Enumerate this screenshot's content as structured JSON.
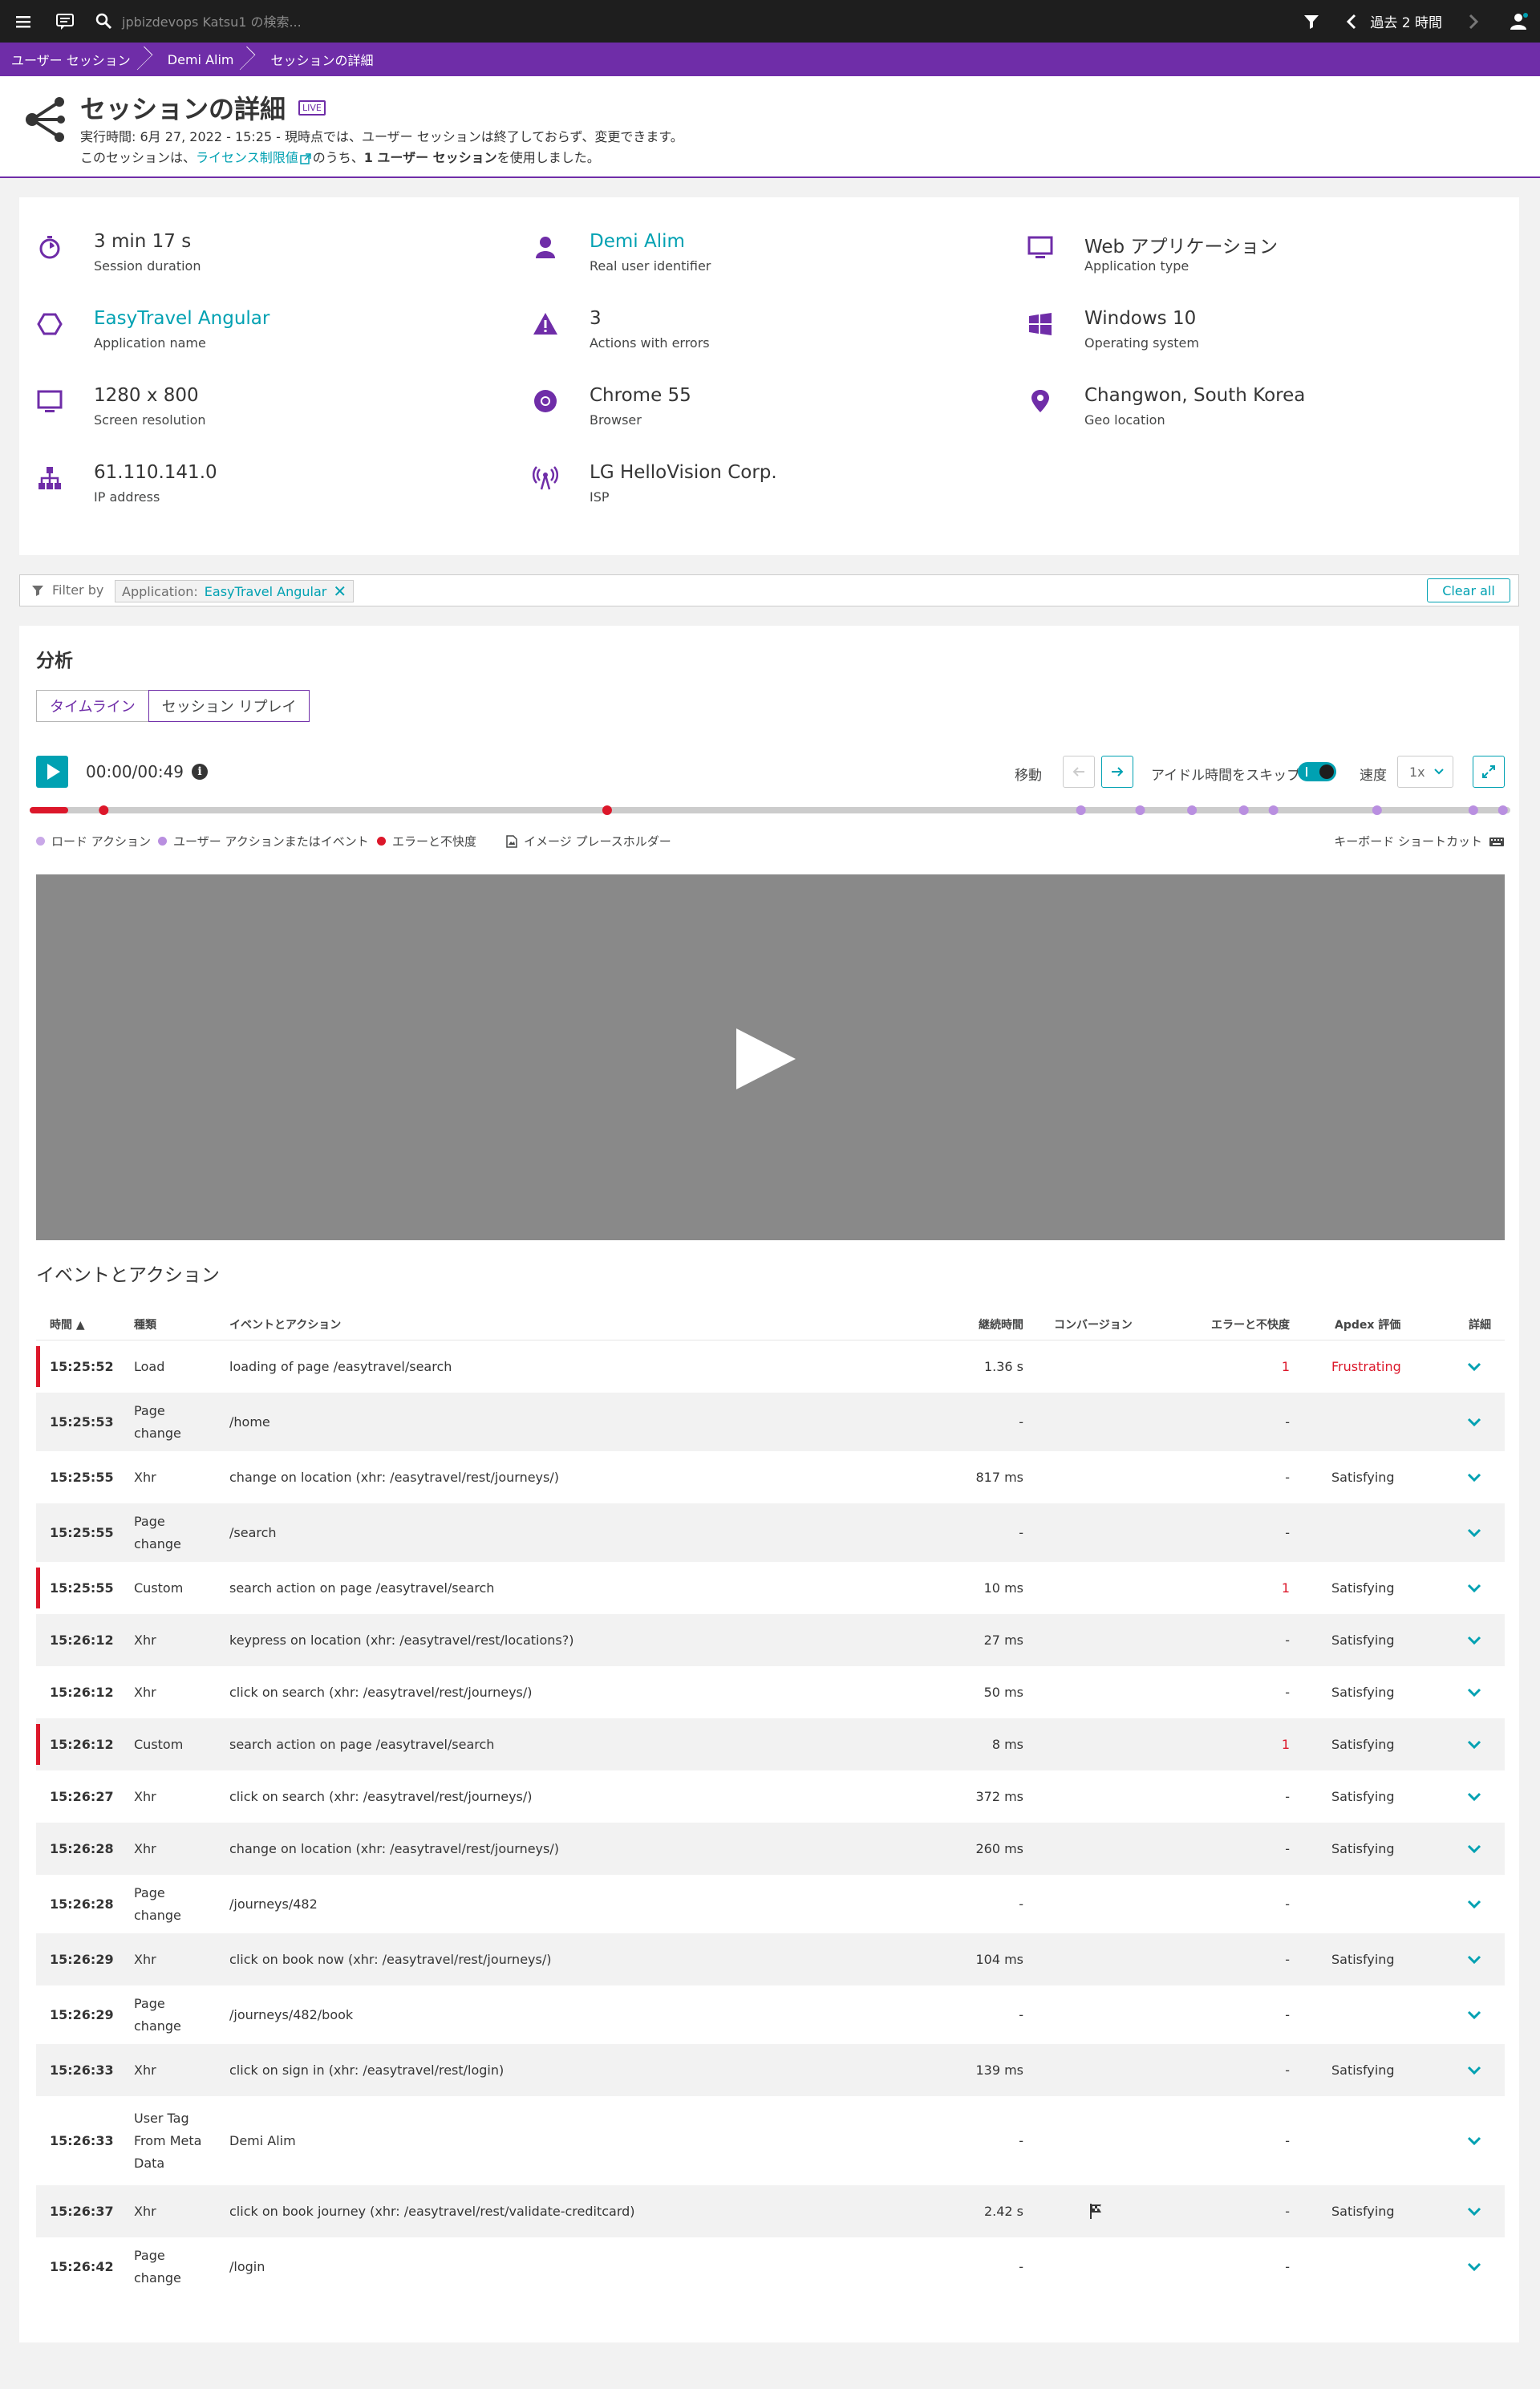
{
  "topbar": {
    "search_placeholder": "jpbizdevops Katsu1 の検索...",
    "timeframe": "過去 2 時間",
    "icons": [
      "menu-icon",
      "chat-icon",
      "search-icon",
      "filter-icon",
      "chevron-left-icon",
      "chevron-right-icon",
      "user-icon"
    ]
  },
  "breadcrumb": [
    "ユーザー セッション",
    "Demi Alim",
    "セッションの詳細"
  ],
  "header": {
    "title": "セッションの詳細",
    "badge": "LIVE",
    "line1": "実行時間: 6月 27, 2022 - 15:25 - 現時点では、ユーザー セッションは終了しておらず、変更できます。",
    "line2_prefix": "このセッションは、",
    "line2_link": "ライセンス制限値",
    "line2_mid": "のうち、",
    "line2_bold": "1 ユーザー セッション",
    "line2_suffix": "を使用しました。"
  },
  "properties": [
    {
      "icon": "stopwatch-icon",
      "value": "3 min 17 s",
      "label": "Session duration",
      "link": false
    },
    {
      "icon": "user-icon",
      "value": "Demi Alim",
      "label": "Real user identifier",
      "link": true
    },
    {
      "icon": "monitor-icon",
      "value": "Web アプリケーション",
      "label": "Application type",
      "link": false
    },
    {
      "icon": "hexagon-icon",
      "value": "EasyTravel Angular",
      "label": "Application name",
      "link": true
    },
    {
      "icon": "warning-icon",
      "value": "3",
      "label": "Actions with errors",
      "link": false
    },
    {
      "icon": "windows-icon",
      "value": "Windows 10",
      "label": "Operating system",
      "link": false
    },
    {
      "icon": "screen-icon",
      "value": "1280 x 800",
      "label": "Screen resolution",
      "link": false
    },
    {
      "icon": "chrome-icon",
      "value": "Chrome 55",
      "label": "Browser",
      "link": false
    },
    {
      "icon": "location-pin-icon",
      "value": "Changwon, South Korea",
      "label": "Geo location",
      "link": false
    },
    {
      "icon": "network-icon",
      "value": "61.110.141.0",
      "label": "IP address",
      "link": false
    },
    {
      "icon": "antenna-icon",
      "value": "LG HelloVision Corp.",
      "label": "ISP",
      "link": false
    }
  ],
  "filter": {
    "label": "Filter by",
    "chip_key": "Application:",
    "chip_value": "EasyTravel Angular",
    "clear_all": "Clear all"
  },
  "analysis": {
    "title": "分析",
    "tabs": [
      "タイムライン",
      "セッション リプレイ"
    ],
    "player_time": "00:00/00:49",
    "move_label": "移動",
    "skip_idle_label": "アイドル時間をスキップ",
    "speed_label": "速度",
    "speed_value": "1x",
    "timeline_markers": [
      {
        "kind": "error",
        "at": 0.05
      },
      {
        "kind": "error",
        "at": 0.39
      },
      {
        "kind": "action",
        "at": 0.71
      },
      {
        "kind": "action",
        "at": 0.75
      },
      {
        "kind": "action",
        "at": 0.785
      },
      {
        "kind": "action",
        "at": 0.82
      },
      {
        "kind": "action",
        "at": 0.84
      },
      {
        "kind": "action",
        "at": 0.91
      },
      {
        "kind": "action",
        "at": 0.975
      },
      {
        "kind": "action",
        "at": 0.995
      }
    ],
    "legend": [
      "ロード アクション",
      "ユーザー アクションまたはイベント",
      "エラーと不快度",
      "イメージ プレースホルダー"
    ],
    "keyboard_shortcut": "キーボード ショートカット",
    "colors": {
      "load": "#c9a8e8",
      "action": "#b98fe0",
      "error": "#dc172a",
      "accent": "#00a1b2",
      "brand": "#6f2da8"
    }
  },
  "events": {
    "title": "イベントとアクション",
    "columns": [
      "時間 ▲",
      "種類",
      "イベントとアクション",
      "継続時間",
      "コンバージョン",
      "エラーと不快度",
      "Apdex 評価",
      "詳細"
    ],
    "rows": [
      {
        "time": "15:25:52",
        "type": "Load",
        "event": "loading of page /easytravel/search",
        "duration": "1.36 s",
        "conversion": "",
        "errors": "1",
        "apdex": "Frustrating",
        "error": true
      },
      {
        "time": "15:25:53",
        "type": "Page\nchange",
        "event": "/home",
        "duration": "-",
        "conversion": "",
        "errors": "-",
        "apdex": "",
        "error": false
      },
      {
        "time": "15:25:55",
        "type": "Xhr",
        "event": "change on location (xhr: /easytravel/rest/journeys/)",
        "duration": "817 ms",
        "conversion": "",
        "errors": "-",
        "apdex": "Satisfying",
        "error": false
      },
      {
        "time": "15:25:55",
        "type": "Page\nchange",
        "event": "/search",
        "duration": "-",
        "conversion": "",
        "errors": "-",
        "apdex": "",
        "error": false
      },
      {
        "time": "15:25:55",
        "type": "Custom",
        "event": "search action on page /easytravel/search",
        "duration": "10 ms",
        "conversion": "",
        "errors": "1",
        "apdex": "Satisfying",
        "error": true
      },
      {
        "time": "15:26:12",
        "type": "Xhr",
        "event": "keypress on location (xhr: /easytravel/rest/locations?)",
        "duration": "27 ms",
        "conversion": "",
        "errors": "-",
        "apdex": "Satisfying",
        "error": false
      },
      {
        "time": "15:26:12",
        "type": "Xhr",
        "event": "click on search (xhr: /easytravel/rest/journeys/)",
        "duration": "50 ms",
        "conversion": "",
        "errors": "-",
        "apdex": "Satisfying",
        "error": false
      },
      {
        "time": "15:26:12",
        "type": "Custom",
        "event": "search action on page /easytravel/search",
        "duration": "8 ms",
        "conversion": "",
        "errors": "1",
        "apdex": "Satisfying",
        "error": true
      },
      {
        "time": "15:26:27",
        "type": "Xhr",
        "event": "click on search (xhr: /easytravel/rest/journeys/)",
        "duration": "372 ms",
        "conversion": "",
        "errors": "-",
        "apdex": "Satisfying",
        "error": false
      },
      {
        "time": "15:26:28",
        "type": "Xhr",
        "event": "change on location (xhr: /easytravel/rest/journeys/)",
        "duration": "260 ms",
        "conversion": "",
        "errors": "-",
        "apdex": "Satisfying",
        "error": false
      },
      {
        "time": "15:26:28",
        "type": "Page\nchange",
        "event": "/journeys/482",
        "duration": "-",
        "conversion": "",
        "errors": "-",
        "apdex": "",
        "error": false
      },
      {
        "time": "15:26:29",
        "type": "Xhr",
        "event": "click on book now (xhr: /easytravel/rest/journeys/)",
        "duration": "104 ms",
        "conversion": "",
        "errors": "-",
        "apdex": "Satisfying",
        "error": false
      },
      {
        "time": "15:26:29",
        "type": "Page\nchange",
        "event": "/journeys/482/book",
        "duration": "-",
        "conversion": "",
        "errors": "-",
        "apdex": "",
        "error": false
      },
      {
        "time": "15:26:33",
        "type": "Xhr",
        "event": "click on sign in (xhr: /easytravel/rest/login)",
        "duration": "139 ms",
        "conversion": "",
        "errors": "-",
        "apdex": "Satisfying",
        "error": false
      },
      {
        "time": "15:26:33",
        "type": "User Tag\nFrom Meta\nData",
        "event": "Demi Alim",
        "duration": "-",
        "conversion": "",
        "errors": "-",
        "apdex": "",
        "error": false
      },
      {
        "time": "15:26:37",
        "type": "Xhr",
        "event": "click on book journey (xhr: /easytravel/rest/validate-creditcard)",
        "duration": "2.42 s",
        "conversion": "flag-icon",
        "errors": "-",
        "apdex": "Satisfying",
        "error": false
      },
      {
        "time": "15:26:42",
        "type": "Page\nchange",
        "event": "/login",
        "duration": "-",
        "conversion": "",
        "errors": "-",
        "apdex": "",
        "error": false
      }
    ]
  }
}
